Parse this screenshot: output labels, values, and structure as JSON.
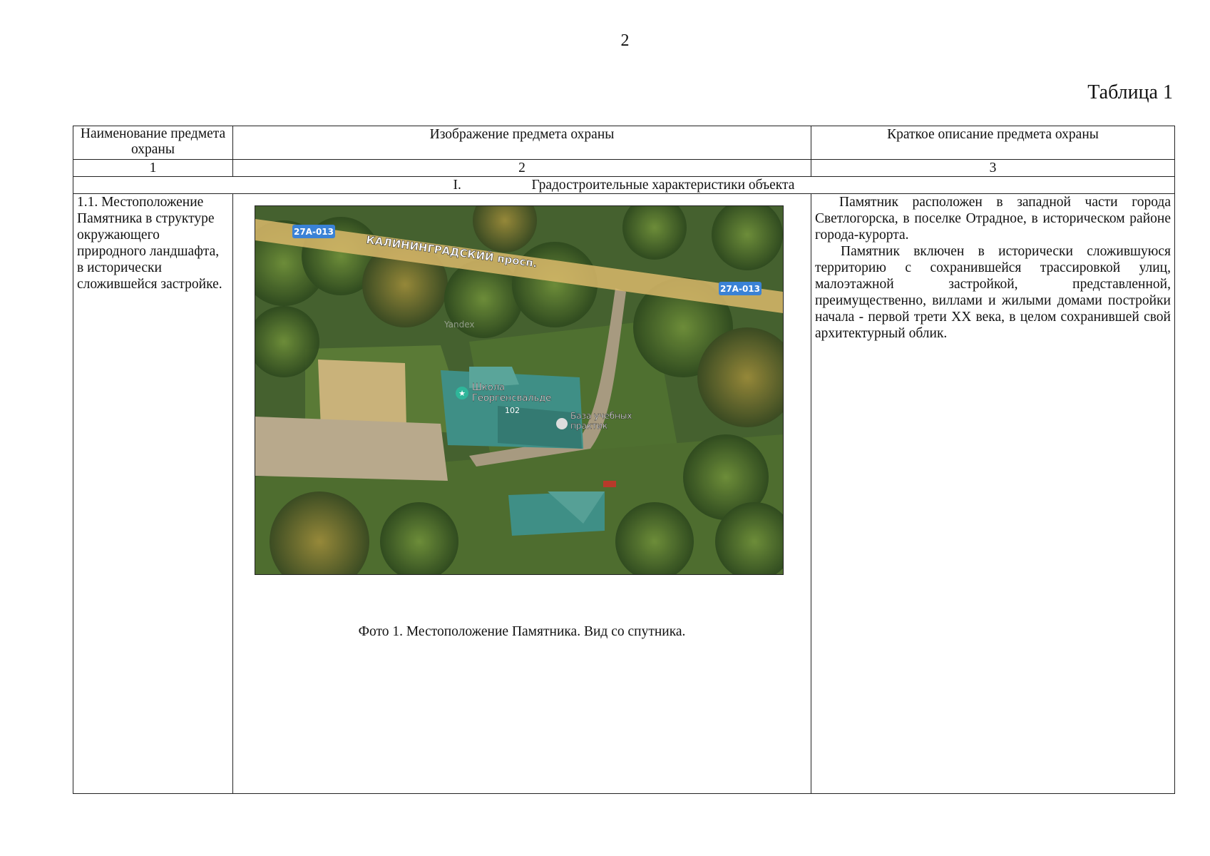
{
  "page_number": "2",
  "table_caption": "Таблица 1",
  "headers": {
    "col1": "Наименование предмета охраны",
    "col2": "Изображение предмета охраны",
    "col3": "Краткое описание предмета охраны"
  },
  "column_numbers": [
    "1",
    "2",
    "3"
  ],
  "section": {
    "roman": "I.",
    "title": "Градостроительные характеристики объекта"
  },
  "row": {
    "name": "1.1. Местоположение Памятника в структуре окружающего природного ландшафта, в исторически сложившейся застройке.",
    "photo_caption": "Фото 1. Местоположение Памятника. Вид со спутника.",
    "description_p1": "Памятник расположен в западной части города Светлогорска, в поселке Отрадное, в историческом районе города-курорта.",
    "description_p2": "Памятник включен в исторически сложившуюся территорию с сохранившейся трассировкой улиц, малоэтажной застройкой, представленной, преимущественно, виллами и жилыми домами постройки начала - первой трети XX века, в целом сохранившей свой архитектурный облик."
  },
  "map": {
    "road_badge_left": "27А-013",
    "road_badge_right": "27А-013",
    "street_name": "КАЛИНИНГРАДСКИЙ просп.",
    "watermark": "Yandex",
    "poi_school_line1": "Школа",
    "poi_school_line2": "Георгенсвальде",
    "house_number": "102",
    "poi_base_line1": "База учебных",
    "poi_base_line2": "практик",
    "road_color": "#d9b86a",
    "badge_color": "#3a82d6",
    "roof_color": "#3f8f86"
  }
}
